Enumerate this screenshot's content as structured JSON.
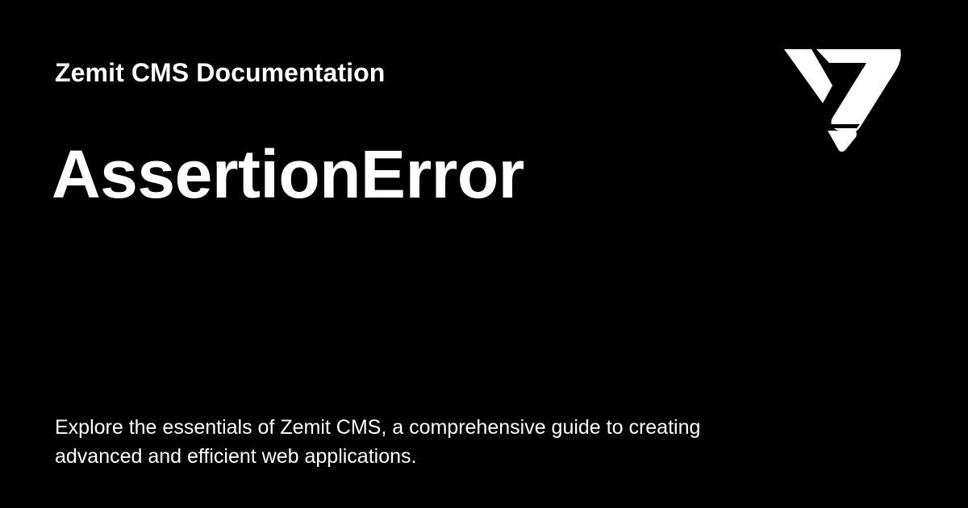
{
  "card": {
    "site_title": "Zemit CMS Documentation",
    "page_title": "AssertionError",
    "description": "Explore the essentials of Zemit CMS, a comprehensive guide to creating advanced and efficient web applications."
  },
  "logo": {
    "icon": "zemit-logo-icon"
  },
  "colors": {
    "background": "#000000",
    "text": "#ffffff"
  }
}
